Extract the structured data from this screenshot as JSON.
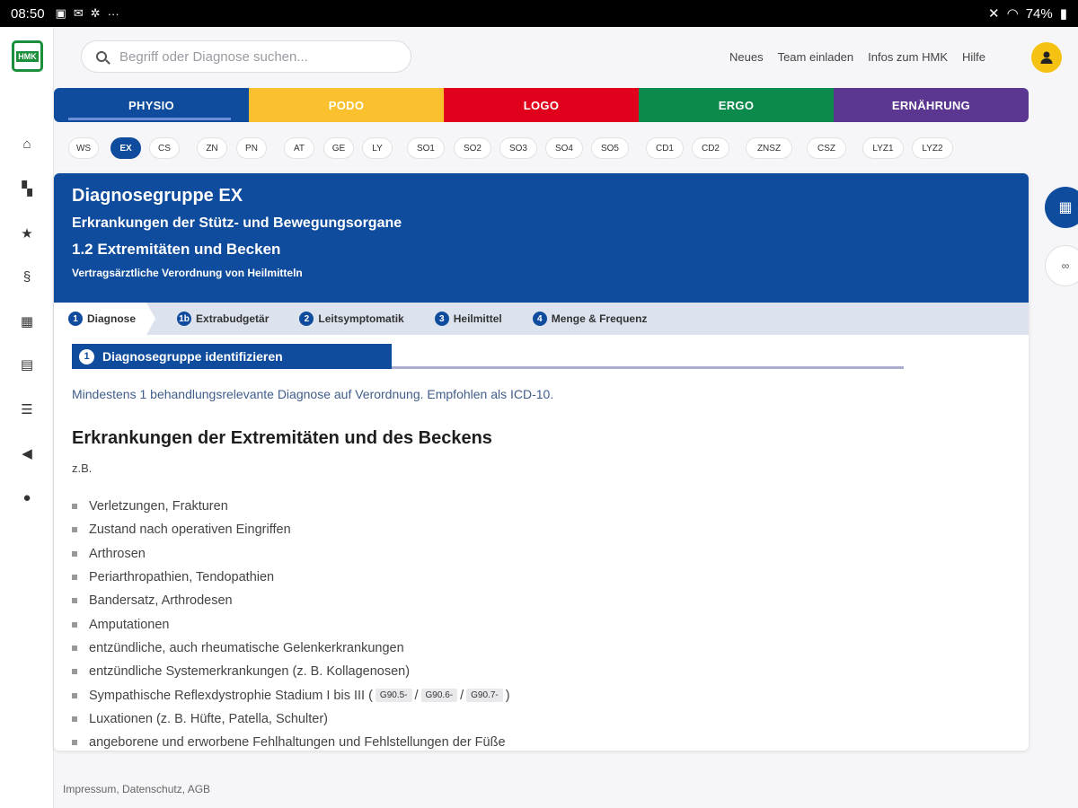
{
  "status": {
    "time": "08:50",
    "battery": "74%"
  },
  "logo_text": "HMK",
  "search": {
    "placeholder": "Begriff oder Diagnose suchen..."
  },
  "top_links": [
    "Neues",
    "Team einladen",
    "Infos zum HMK",
    "Hilfe"
  ],
  "disciplines": [
    {
      "label": "PHYSIO",
      "color": "#0f4c9d"
    },
    {
      "label": "PODO",
      "color": "#fbc02d"
    },
    {
      "label": "LOGO",
      "color": "#e0001b"
    },
    {
      "label": "ERGO",
      "color": "#0b8a4c"
    },
    {
      "label": "ERNÄHRUNG",
      "color": "#5c3791"
    }
  ],
  "chips": [
    "WS",
    "EX",
    "CS",
    "ZN",
    "PN",
    "AT",
    "GE",
    "LY",
    "SO1",
    "SO2",
    "SO3",
    "SO4",
    "SO5",
    "CD1",
    "CD2",
    "ZNSZ",
    "CSZ",
    "LYZ1",
    "LYZ2"
  ],
  "active_chip": "EX",
  "card": {
    "title": "Diagnosegruppe EX",
    "subtitle": "Erkrankungen der Stütz- und Bewegungsorgane",
    "section": "1.2 Extremitäten und Becken",
    "note": "Vertragsärztliche Verordnung von Heilmitteln"
  },
  "steps": [
    {
      "num": "1",
      "label": "Diagnose"
    },
    {
      "num": "1b",
      "label": "Extrabudgetär"
    },
    {
      "num": "2",
      "label": "Leitsymptomatik"
    },
    {
      "num": "3",
      "label": "Heilmittel"
    },
    {
      "num": "4",
      "label": "Menge & Frequenz"
    }
  ],
  "section_title": {
    "num": "1",
    "label": "Diagnosegruppe identifizieren"
  },
  "intro": "Mindestens 1 behandlungsrelevante Diagnose auf Verordnung. Empfohlen als ICD-10.",
  "category_heading": "Erkrankungen der Extremitäten und des Beckens",
  "zb": "z.B.",
  "items": [
    "Verletzungen, Frakturen",
    "Zustand nach operativen Eingriffen",
    "Arthrosen",
    "Periarthropathien, Tendopathien",
    "Bandersatz, Arthrodesen",
    "Amputationen",
    "entzündliche, auch rheumatische Gelenkerkrankungen",
    "entzündliche Systemerkrankungen (z. B. Kollagenosen)"
  ],
  "sympathic": {
    "prefix": "Sympathische Reflexdystrophie Stadium I bis III (",
    "codes": [
      "G90.5-",
      "G90.6-",
      "G90.7-"
    ],
    "sep": "/",
    "suffix": ")"
  },
  "items_after": [
    "Luxationen (z. B. Hüfte, Patella, Schulter)",
    "angeborene und erworbene Fehlhaltungen und Fehlstellungen der Füße"
  ],
  "footer": "Impressum, Datenschutz, AGB"
}
